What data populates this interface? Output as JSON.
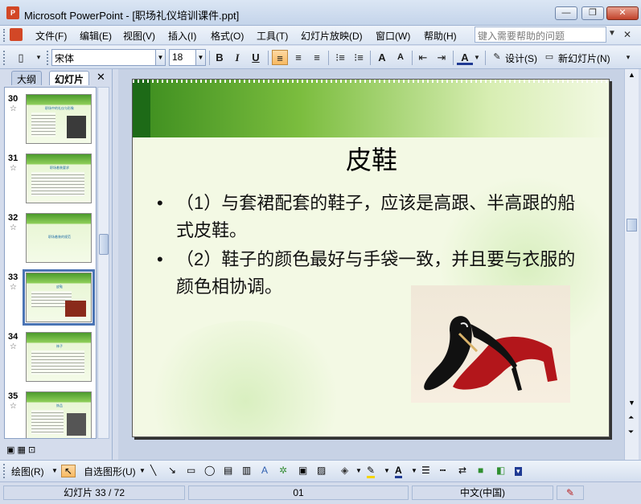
{
  "window": {
    "app_title": "Microsoft PowerPoint - [职场礼仪培训课件.ppt]",
    "minimize": "—",
    "restore": "❐",
    "close": "✕"
  },
  "menu": {
    "items": [
      "文件(F)",
      "编辑(E)",
      "视图(V)",
      "插入(I)",
      "格式(O)",
      "工具(T)",
      "幻灯片放映(D)",
      "窗口(W)",
      "帮助(H)"
    ],
    "help_placeholder": "键入需要帮助的问题",
    "close_doc": "✕"
  },
  "toolbar": {
    "font_name": "宋体",
    "font_size": "18",
    "bold": "B",
    "italic": "I",
    "underline": "U",
    "design_label": "设计(S)",
    "new_slide_label": "新幻灯片(N)",
    "grow_font": "A",
    "shrink_font": "A",
    "font_color": "A"
  },
  "left_pane": {
    "tabs": [
      "大纲",
      "幻灯片"
    ],
    "close": "✕",
    "thumbnails": [
      {
        "number": "30",
        "title": "职场中的礼仪与形象"
      },
      {
        "number": "31",
        "title": "职场着装要求"
      },
      {
        "number": "32",
        "title": "职场着装的规范"
      },
      {
        "number": "33",
        "title": "皮鞋"
      },
      {
        "number": "34",
        "title": "袜子"
      },
      {
        "number": "35",
        "title": "饰品"
      }
    ],
    "selected_index": 3,
    "star": "☆"
  },
  "slide": {
    "title": "皮鞋",
    "bullets": [
      "（1）与套裙配套的鞋子，应该是高跟、半高跟的船式皮鞋。",
      "（2）鞋子的颜色最好与手袋一致，并且要与衣服的颜色相协调。"
    ],
    "bullet_char": "•"
  },
  "drawbar": {
    "draw_label": "绘图(R)",
    "autoshapes_label": "自选图形(U)",
    "text_color": "A"
  },
  "status": {
    "slide_info": "幻灯片 33 / 72",
    "design_name": "01",
    "language": "中文(中国)"
  }
}
